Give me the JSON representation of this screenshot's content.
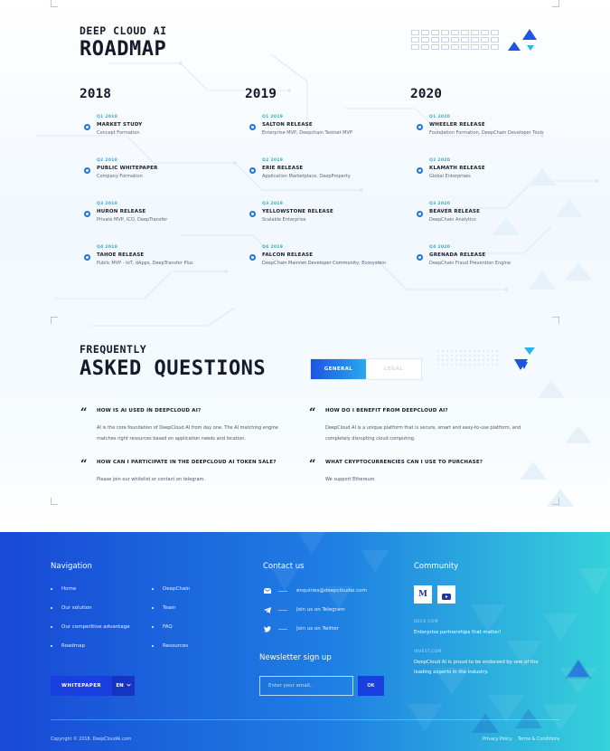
{
  "roadmap": {
    "eyebrow": "DEEP CLOUD AI",
    "title": "ROADMAP",
    "years": [
      {
        "year": "2018",
        "milestones": [
          {
            "quarter": "Q1 2018",
            "title": "MARKET STUDY",
            "desc": "Concept Formation"
          },
          {
            "quarter": "Q2 2018",
            "title": "PUBLIC WHITEPAPER",
            "desc": "Company Formation"
          },
          {
            "quarter": "Q3 2018",
            "title": "HURON RELEASE",
            "desc": "Private MVP, ICO, DeepTransfer"
          },
          {
            "quarter": "Q4 2018",
            "title": "TAHOE RELEASE",
            "desc": "Public MVP - IoT, dApps, DeepTransfer Plus"
          }
        ]
      },
      {
        "year": "2019",
        "milestones": [
          {
            "quarter": "Q1 2019",
            "title": "SALTON RELEASE",
            "desc": "Enterprise MVP, Deepchain Testnet MVP"
          },
          {
            "quarter": "Q2 2019",
            "title": "ERIE RELEASE",
            "desc": "Application Marketplace, DeepProperty"
          },
          {
            "quarter": "Q3 2019",
            "title": "YELLOWSTONE RELEASE",
            "desc": "Scalable Enterprise"
          },
          {
            "quarter": "Q4 2019",
            "title": "FALCON RELEASE",
            "desc": "DeepChain Mainnet Developer Community, Ecosystem"
          }
        ]
      },
      {
        "year": "2020",
        "milestones": [
          {
            "quarter": "Q1 2020",
            "title": "WHEELER RELEASE",
            "desc": "Foundation Formation, DeepChain Developer Tools"
          },
          {
            "quarter": "Q2 2020",
            "title": "KLAMATH RELEASE",
            "desc": "Global Enterprises"
          },
          {
            "quarter": "Q3 2020",
            "title": "BEAVER RELEASE",
            "desc": "DeepChain Analytics"
          },
          {
            "quarter": "Q4 2020",
            "title": "GRENADA RELEASE",
            "desc": "DeepChain Fraud Prevention Engine"
          }
        ]
      }
    ]
  },
  "faq": {
    "eyebrow": "FREQUENTLY",
    "title": "ASKED QUESTIONS",
    "tabs": [
      "GENERAL",
      "LEGAL"
    ],
    "active_tab": "GENERAL",
    "items": [
      {
        "q": "HOW IS AI USED IN DEEPCLOUD AI?",
        "a1": "AI is the core foundation of DeepCloud AI from day one. The AI matching engine",
        "a2": "matches right resources based on application needs and location."
      },
      {
        "q": "HOW DO I BENEFIT FROM DEEPCLOUD AI?",
        "a1": "DeepCloud AI is a unique platform that is secure, smart and easy-to-use platform, and",
        "a2": "completely disrupting cloud computing."
      },
      {
        "q": "HOW CAN I PARTICIPATE IN THE DEEPCLOUD AI TOKEN SALE?",
        "a1": "Please join our whitelist or contact on telegram.",
        "a2": ""
      },
      {
        "q": "WHAT CRYPTOCURRENCIES CAN I USE TO PURCHASE?",
        "a1": "We support Ethereum",
        "a2": ""
      }
    ]
  },
  "footer": {
    "navigation": {
      "heading": "Navigation",
      "col1": [
        "Home",
        "Our solution",
        "Our competitive advantage",
        "Roadmap"
      ],
      "col2": [
        "DeepChain",
        "Team",
        "FAQ",
        "Resources"
      ]
    },
    "contact": {
      "heading": "Contact us",
      "email": "enquiries@deepcloudai.com",
      "telegram": "Join us on Telegram",
      "twitter": "Join us on Twitter"
    },
    "community": {
      "heading": "Community",
      "news": [
        {
          "label": "DECK.COM",
          "text": "Enterprise partnerships that matter!"
        },
        {
          "label": "INVEST.COM",
          "text1": "DeepCloud AI is proud to be endorsed by one of the",
          "text2": "leading experts in the industry."
        }
      ]
    },
    "newsletter": {
      "heading": "Newsletter sign up",
      "placeholder": "Enter your email..",
      "button": "OK"
    },
    "whitepaper_button": "WHITEPAPER",
    "language": "EN",
    "copyright": "Copyright © 2018. DeepCloudAi.com",
    "links": [
      "Privacy Policy",
      "Terms & Conditions"
    ]
  },
  "colors": {
    "accent_blue": "#1c55e0",
    "accent_cyan": "#21b3d6",
    "footer_gradient_start": "#1849d6",
    "footer_gradient_end": "#36d2da"
  }
}
